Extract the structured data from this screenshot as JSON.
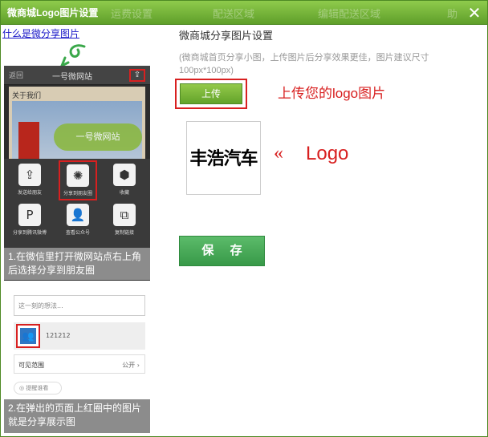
{
  "dialog": {
    "title": "微商城Logo图片设置",
    "background_tabs": [
      "运费设置",
      "配送区域",
      "编辑配送区域",
      "助"
    ],
    "close_glyph": "✕"
  },
  "guide": {
    "link": "什么是微分享图片",
    "phone1": {
      "back": "返回",
      "title": "一号微网站",
      "about": "关于我们",
      "banner_button": "一号微网站",
      "share_glyph": "⇪",
      "tiles": [
        {
          "label": "发送给朋友",
          "glyph": "⇪"
        },
        {
          "label": "分享到朋友圈",
          "glyph": "✺"
        },
        {
          "label": "收藏",
          "glyph": "⬢"
        },
        {
          "label": "分享到腾讯微博",
          "glyph": "P"
        },
        {
          "label": "查看公众号",
          "glyph": "👤"
        },
        {
          "label": "复制链接",
          "glyph": "⧉"
        }
      ]
    },
    "caption1": "1.在微信里打开微网站点右上角后选择分享到朋友圈",
    "phone2": {
      "input_placeholder": "这一刻的想法...",
      "number": "121212",
      "visible_range": "可见范围",
      "public": "公开 ›",
      "remind": "◎ 提醒谁看"
    },
    "caption2": "2.在弹出的页面上红圈中的图片就是分享展示图"
  },
  "settings": {
    "title": "微商城分享图片设置",
    "hint": "(微商城首页分享小图，上传图片后分享效果更佳，图片建议尺寸100px*100px)",
    "upload_label": "上传",
    "upload_note": "上传您的logo图片",
    "logo_text": "丰浩汽车",
    "logo_arrow": "«",
    "logo_label": "Logo",
    "save_label": "保 存"
  }
}
